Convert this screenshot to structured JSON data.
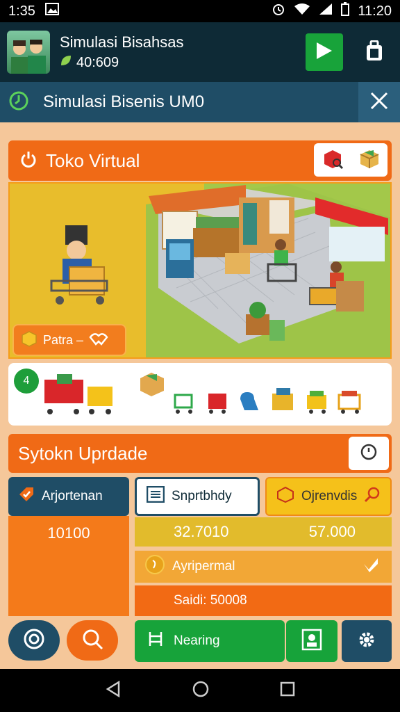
{
  "status": {
    "time_left": "1:35",
    "time_right": "11:20"
  },
  "appbar": {
    "title": "Simulasi Bisahsas",
    "balance": "40:609"
  },
  "subbar": {
    "title": "Simulasi Bisenis UM0"
  },
  "store": {
    "title": "Toko Virtual",
    "partner_label": "Patra –"
  },
  "tray": {
    "count": "4"
  },
  "upgrade": {
    "title": "Sytokn Uprdade",
    "tabs": [
      "Arjortenan",
      "Snprtbhdy",
      "Ojrenvdis"
    ],
    "left_value": "10100",
    "value_a": "32.7010",
    "value_b": "57.000",
    "detail_label": "Ayripermal",
    "total_label": "Saidi: 50008"
  },
  "actions": {
    "learning_label": "Nearing"
  },
  "colors": {
    "accent_orange": "#f06a16",
    "navy": "#1f4d66",
    "green": "#17a33a",
    "yellow": "#f5c11a"
  }
}
